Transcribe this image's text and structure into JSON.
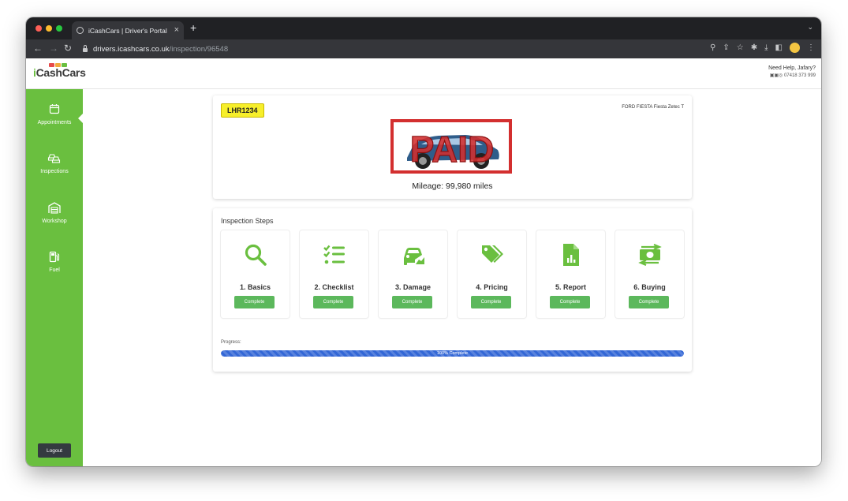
{
  "browser": {
    "tab_title": "iCashCars | Driver's Portal",
    "url_host": "drivers.icashcars.co.uk",
    "url_path": "/inspection/96548"
  },
  "header": {
    "logo_i": "i",
    "logo_rest": "CashCars",
    "help_title": "Need Help, Jafary?",
    "help_phone": "07418 373 999"
  },
  "sidebar": {
    "items": [
      {
        "label": "Appointments",
        "icon": "calendar-icon",
        "active": true
      },
      {
        "label": "Inspections",
        "icon": "cars-icon",
        "active": false
      },
      {
        "label": "Workshop",
        "icon": "garage-icon",
        "active": false
      },
      {
        "label": "Fuel",
        "icon": "fuel-icon",
        "active": false
      }
    ],
    "logout_label": "Logout"
  },
  "vehicle": {
    "plate": "LHR1234",
    "model": "FORD FIESTA Fiesta Zetec T",
    "stamp": "PAID",
    "mileage": "Mileage: 99,980 miles"
  },
  "inspection": {
    "title": "Inspection Steps",
    "steps": [
      {
        "label": "1. Basics",
        "status": "Complete",
        "icon": "search-icon"
      },
      {
        "label": "2. Checklist",
        "status": "Complete",
        "icon": "checklist-icon"
      },
      {
        "label": "3. Damage",
        "status": "Complete",
        "icon": "car-damage-icon"
      },
      {
        "label": "4. Pricing",
        "status": "Complete",
        "icon": "price-tag-icon"
      },
      {
        "label": "5. Report",
        "status": "Complete",
        "icon": "report-icon"
      },
      {
        "label": "6. Buying",
        "status": "Complete",
        "icon": "money-exchange-icon"
      }
    ],
    "progress_label": "Progress:",
    "progress_percent": 100,
    "progress_text": "100% Complete"
  },
  "colors": {
    "brand_green": "#6abf3f",
    "button_green": "#5cb85c",
    "progress_blue": "#3367d6",
    "plate_yellow": "#f7ef2b",
    "stamp_red": "#d32f2f"
  }
}
